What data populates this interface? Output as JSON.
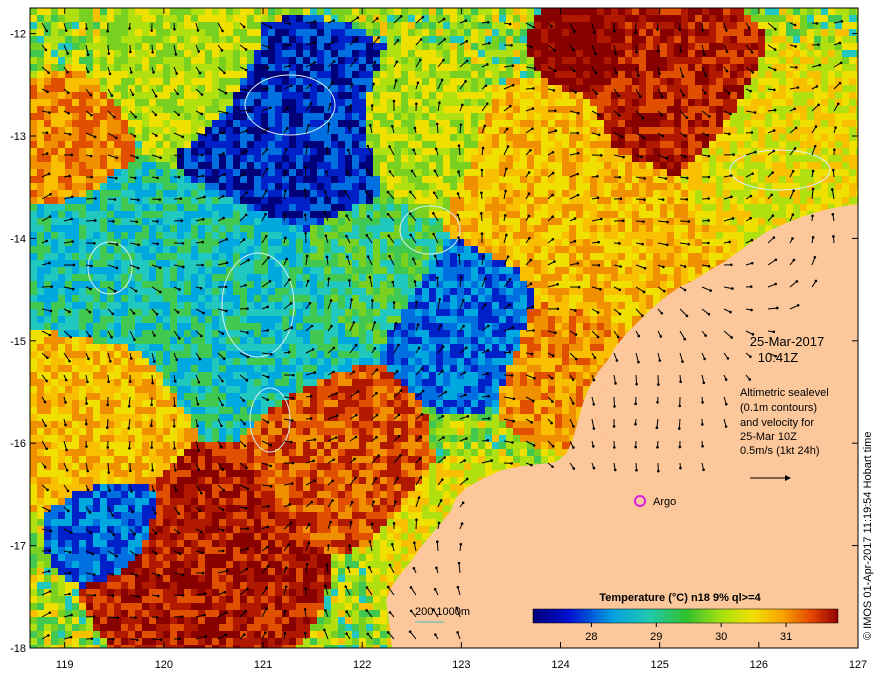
{
  "map": {
    "x_axis": {
      "ticks": [
        "119",
        "120",
        "121",
        "122",
        "123",
        "124",
        "125",
        "126",
        "127"
      ],
      "range": [
        118.65,
        127.0
      ]
    },
    "y_axis": {
      "ticks": [
        "-12",
        "-13",
        "-14",
        "-15",
        "-16",
        "-17",
        "-18"
      ],
      "range": [
        -18.0,
        -11.75
      ]
    },
    "land_color": "#fbc79b",
    "contour_color": "#d9f0f5",
    "arrow_color": "#000000"
  },
  "annotations": {
    "date": "25-Mar-2017",
    "time": "10:41Z",
    "altimetry_lines": [
      "Altimetric sealevel",
      "(0.1m contours)",
      "and velocity for",
      "25-Mar 10Z",
      "0.5m/s (1kt 24h)"
    ],
    "argo_label": "Argo",
    "isobath_label": "200  1000m",
    "credit": "© IMOS 01-Apr-2017 11:19:54 Hobart time"
  },
  "colorbar": {
    "title": "Temperature (°C) n18 9% ql>=4",
    "ticks": [
      "28",
      "29",
      "30",
      "31"
    ],
    "tick_values": [
      28,
      29,
      30,
      31
    ],
    "range": [
      27.1,
      31.8
    ]
  }
}
